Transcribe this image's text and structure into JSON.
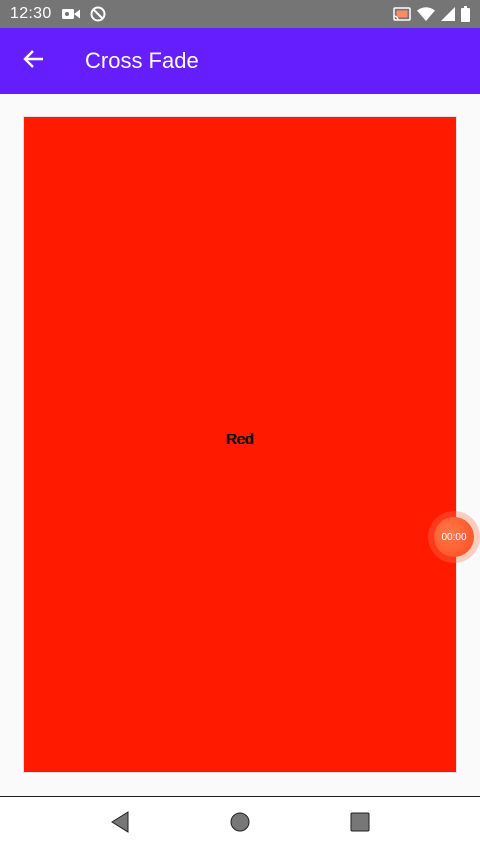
{
  "status_bar": {
    "time": "12:30",
    "icons_left": [
      "video-camera-icon",
      "do-not-disturb-icon"
    ],
    "icons_right": [
      "cast-icon",
      "wifi-icon",
      "cellular-signal-icon",
      "battery-icon"
    ]
  },
  "app_bar": {
    "title": "Cross Fade",
    "back_icon": "arrow-back-icon",
    "background_color": "#651fff"
  },
  "panel": {
    "label": "Red",
    "color": "#ff1a00"
  },
  "timer": {
    "label": "00:00",
    "color": "#ff5a2a"
  },
  "nav_bar": {
    "buttons": [
      "back-triangle-icon",
      "home-circle-icon",
      "recents-square-icon"
    ]
  }
}
